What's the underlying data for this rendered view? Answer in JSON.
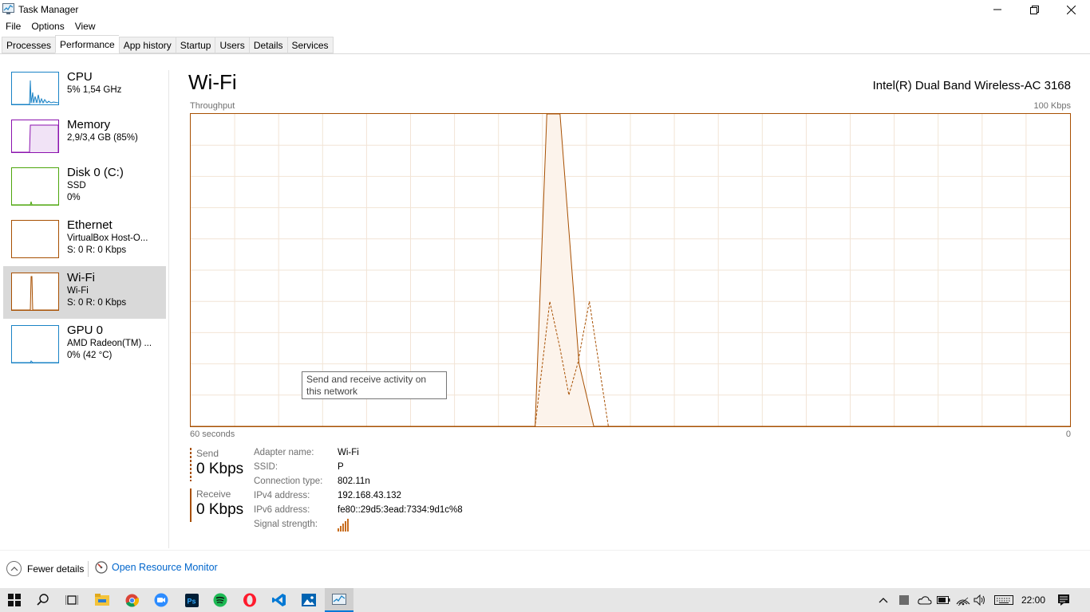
{
  "window": {
    "title": "Task Manager"
  },
  "menu": [
    "File",
    "Options",
    "View"
  ],
  "tabs": [
    "Processes",
    "Performance",
    "App history",
    "Startup",
    "Users",
    "Details",
    "Services"
  ],
  "sidebar": [
    {
      "name": "CPU",
      "line1": "5% 1,54 GHz",
      "line2": "",
      "color": "#1a83c6"
    },
    {
      "name": "Memory",
      "line1": "2,9/3,4 GB (85%)",
      "line2": "",
      "color": "#8b12ae"
    },
    {
      "name": "Disk 0 (C:)",
      "line1": "SSD",
      "line2": "0%",
      "color": "#4da60c"
    },
    {
      "name": "Ethernet",
      "line1": "VirtualBox Host-O...",
      "line2": "S: 0 R: 0 Kbps",
      "color": "#a74f01"
    },
    {
      "name": "Wi-Fi",
      "line1": "Wi-Fi",
      "line2": "S: 0 R: 0 Kbps",
      "color": "#a74f01"
    },
    {
      "name": "GPU 0",
      "line1": "AMD Radeon(TM) ...",
      "line2": "0% (42 °C)",
      "color": "#1a83c6"
    }
  ],
  "main": {
    "title": "Wi-Fi",
    "adapter_model": "Intel(R) Dual Band Wireless-AC 3168",
    "graph_label": "Throughput",
    "graph_max": "100 Kbps",
    "graph_time": "60 seconds",
    "graph_min": "0",
    "tooltip": "Send and receive activity on this network"
  },
  "chart_data": {
    "type": "area",
    "title": "Throughput",
    "x_range_seconds": [
      60,
      0
    ],
    "ylim": [
      0,
      100
    ],
    "y_unit": "Kbps",
    "grid": true,
    "series": [
      {
        "name": "Receive",
        "style": "solid",
        "x": [
          60,
          36.5,
          35.7,
          34.8,
          33.5,
          32.5,
          0
        ],
        "values": [
          0,
          0,
          100,
          100,
          20,
          0,
          0
        ]
      },
      {
        "name": "Send",
        "style": "dashed",
        "x": [
          60,
          36.5,
          35.5,
          34.8,
          34.2,
          33.6,
          32.8,
          31.5,
          0
        ],
        "values": [
          0,
          0,
          40,
          25,
          10,
          20,
          40,
          0,
          0
        ]
      }
    ]
  },
  "stats": {
    "send_label": "Send",
    "send_value": "0 Kbps",
    "receive_label": "Receive",
    "receive_value": "0 Kbps"
  },
  "properties": [
    {
      "key": "Adapter name:",
      "value": "Wi-Fi"
    },
    {
      "key": "SSID:",
      "value": "P"
    },
    {
      "key": "Connection type:",
      "value": "802.11n"
    },
    {
      "key": "IPv4 address:",
      "value": "192.168.43.132"
    },
    {
      "key": "IPv6 address:",
      "value": "fe80::29d5:3ead:7334:9d1c%8"
    },
    {
      "key": "Signal strength:",
      "value": ""
    }
  ],
  "footer": {
    "fewer_details": "Fewer details",
    "open_resource_monitor": "Open Resource Monitor"
  },
  "taskbar": {
    "time": "22:00"
  },
  "colors": {
    "accent": "#a74f01",
    "fill": "#fcf3eb",
    "grid": "#f2e4d6",
    "link": "#0066cc"
  }
}
